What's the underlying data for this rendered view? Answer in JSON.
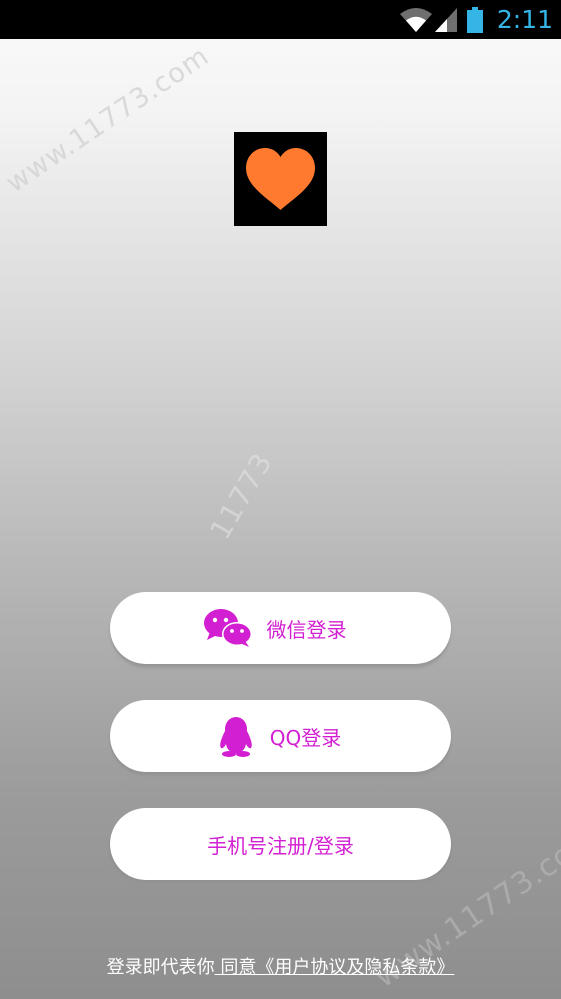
{
  "status_bar": {
    "time": "2:11",
    "icons": [
      "wifi-icon",
      "signal-icon",
      "battery-icon"
    ],
    "time_color": "#34b5e5"
  },
  "app": {
    "logo_icon": "heart-icon",
    "logo_color": "#ff7a2f"
  },
  "watermarks": [
    "www.11773.com",
    "11773",
    "www.11773.com"
  ],
  "buttons": {
    "wechat": {
      "label": "微信登录",
      "icon": "wechat-icon"
    },
    "qq": {
      "label": "QQ登录",
      "icon": "qq-penguin-icon"
    },
    "phone": {
      "label": "手机号注册/登录"
    }
  },
  "accent_color": "#d21fd2",
  "agreement": {
    "prefix": "登录即代表你",
    "link": " 同意《用户协议及隐私条款》"
  }
}
